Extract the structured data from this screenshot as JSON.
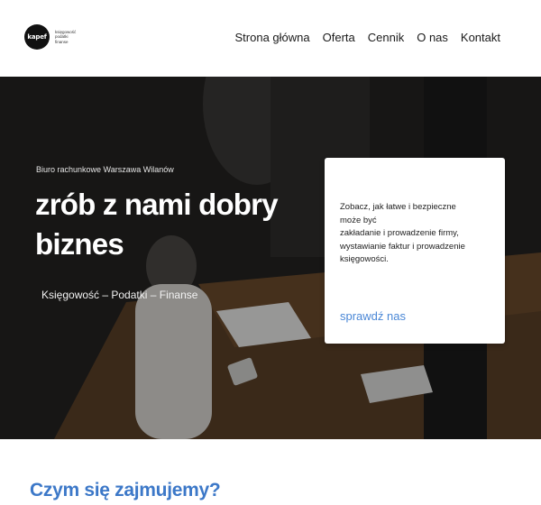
{
  "logo": {
    "mark": "kapef",
    "lines": [
      "księgowość",
      "podatki",
      "finanse"
    ]
  },
  "nav": {
    "items": [
      "Strona główna",
      "Oferta",
      "Cennik",
      "O nas",
      "Kontakt"
    ]
  },
  "hero": {
    "subtitle": "Biuro rachunkowe Warszawa Wilanów",
    "title": "zrób z nami dobry biznes",
    "tagline": "Księgowość – Podatki – Finanse"
  },
  "card": {
    "lines": [
      "Zobacz, jak łatwe i bezpieczne",
      "może być",
      "zakładanie i prowadzenie firmy,",
      "wystawianie faktur i prowadzenie",
      "księgowości."
    ],
    "link": "sprawdź nas"
  },
  "section": {
    "title": "Czym się zajmujemy?"
  },
  "colors": {
    "accent": "#3c78c8",
    "link": "#4a87d6",
    "hero_bg": "#2b241d"
  }
}
